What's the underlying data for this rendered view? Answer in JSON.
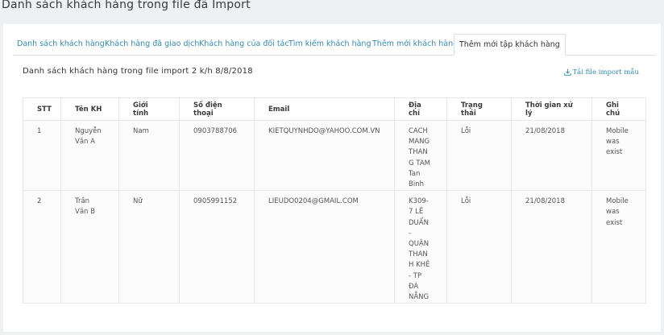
{
  "page_title": "Danh sách khách hàng trong file đã Import",
  "tabs": [
    {
      "label": "Danh sách khách hàng",
      "active": false
    },
    {
      "label": "Khách hàng đã giao dịch",
      "active": false
    },
    {
      "label": "Khách hàng của đối tác",
      "active": false
    },
    {
      "label": "Tìm kiếm khách hàng",
      "active": false
    },
    {
      "label": "Thêm mới khách hàng",
      "active": false
    },
    {
      "label": "Thêm mới tập khách hàng",
      "active": true
    }
  ],
  "list_title": "Danh sách khách hàng trong file import 2 k/h 8/8/2018",
  "template_link": {
    "label": "Tải file import mẫu",
    "icon": "download-icon"
  },
  "table": {
    "headers": [
      "STT",
      "Tên KH",
      "Giới tính",
      "Số điện thoại",
      "Email",
      "Địa chỉ",
      "Trạng thái",
      "Thời gian xử lý",
      "Ghi chú"
    ],
    "rows": [
      {
        "stt": "1",
        "name": "Nguyễn Văn A",
        "gender": "Nam",
        "phone": "0903788706",
        "email": "KIETQUYNHDO@YAHOO.COM.VN",
        "address": "CACH MANG THANG TAM Tan Binh",
        "status": "Lỗi",
        "time": "21/08/2018",
        "note": "Mobile was exist"
      },
      {
        "stt": "2",
        "name": "Trần Văn B",
        "gender": "Nữ",
        "phone": "0905991152",
        "email": "LIEUDO0204@GMAIL.COM",
        "address": "K309-7 LÊ DUẨN - QUẬN THANH KHÊ - TP ĐÀ NẴNG",
        "status": "Lỗi",
        "time": "21/08/2018",
        "note": "Mobile was exist"
      }
    ]
  },
  "colors": {
    "link": "#2a8fbd",
    "background": "#eef0f2",
    "panel": "#ffffff",
    "border": "#e5e7ea"
  }
}
